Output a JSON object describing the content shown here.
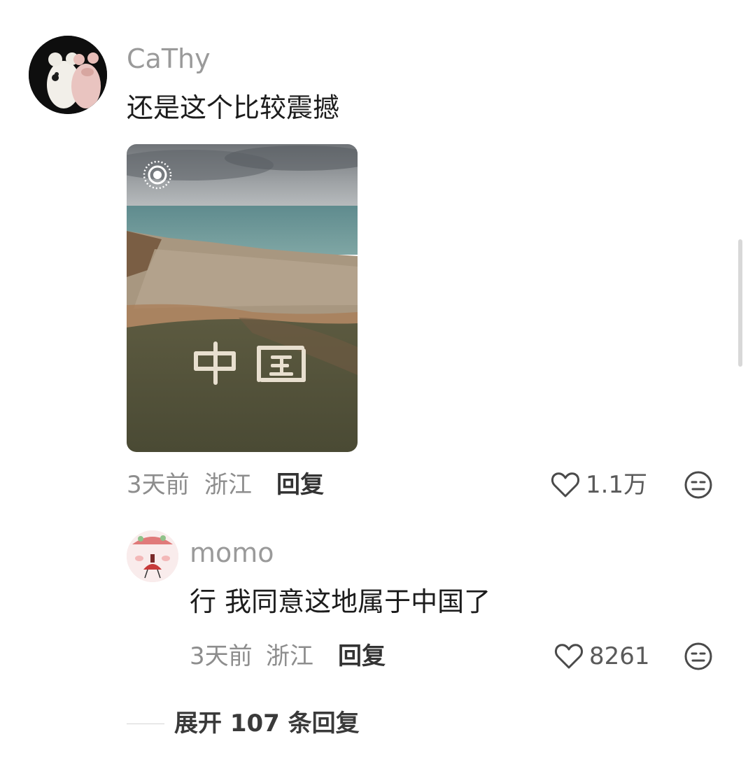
{
  "comment": {
    "username": "CaThy",
    "text": "还是这个比较震撼",
    "time": "3天前",
    "location": "浙江",
    "reply_label": "回复",
    "likes": "1.1万"
  },
  "reply": {
    "username": "momo",
    "text": "行 我同意这地属于中国了",
    "time": "3天前",
    "location": "浙江",
    "reply_label": "回复",
    "likes": "8261"
  },
  "expand_label": "展开 107 条回复",
  "colors": {
    "meta": "#8d8d8d",
    "text": "#1c1c1c",
    "accent": "#333333"
  },
  "icons": {
    "like": "heart-outline-icon",
    "dislike": "meh-face-icon",
    "live_photo": "live-photo-icon"
  }
}
